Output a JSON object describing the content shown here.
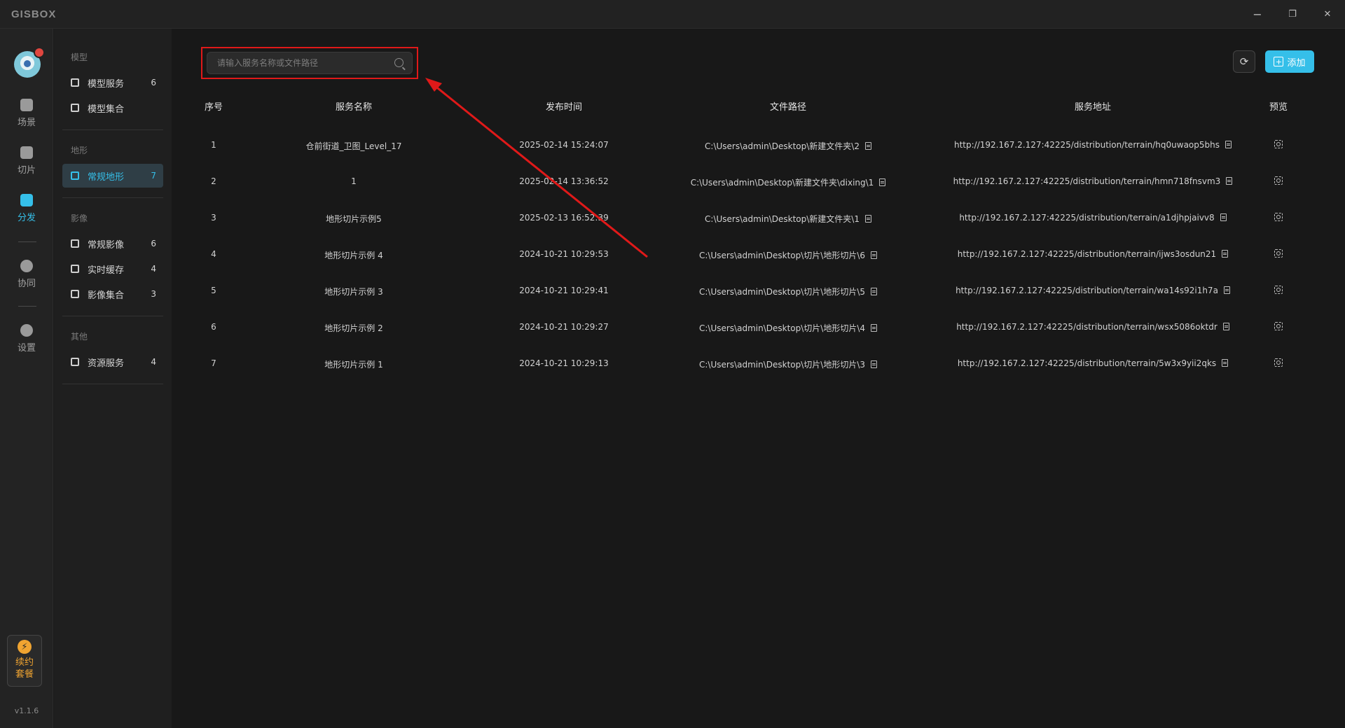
{
  "app": {
    "logo": "GISBOX"
  },
  "window": {
    "minimize": "−",
    "restore": "❐",
    "close": "✕"
  },
  "rail": {
    "items": [
      {
        "label": "场景"
      },
      {
        "label": "切片"
      },
      {
        "label": "分发"
      },
      {
        "label": "协同"
      },
      {
        "label": "设置"
      }
    ],
    "active": "分发",
    "renew": {
      "line1": "续约",
      "line2": "套餐",
      "icon": "⚡"
    },
    "version": "v1.1.6"
  },
  "sidebar": {
    "groups": [
      {
        "title": "模型",
        "items": [
          {
            "label": "模型服务",
            "count": "6"
          },
          {
            "label": "模型集合",
            "count": ""
          }
        ]
      },
      {
        "title": "地形",
        "items": [
          {
            "label": "常规地形",
            "count": "7"
          }
        ]
      },
      {
        "title": "影像",
        "items": [
          {
            "label": "常规影像",
            "count": "6"
          },
          {
            "label": "实时缓存",
            "count": "4"
          },
          {
            "label": "影像集合",
            "count": "3"
          }
        ]
      },
      {
        "title": "其他",
        "items": [
          {
            "label": "资源服务",
            "count": "4"
          }
        ]
      }
    ],
    "active_item": "常规地形"
  },
  "toolbar": {
    "search_placeholder": "请输入服务名称或文件路径",
    "search_value": "",
    "refresh_icon": "⟳",
    "add_label": "添加"
  },
  "table": {
    "headers": [
      "序号",
      "服务名称",
      "发布时间",
      "文件路径",
      "服务地址",
      "预览"
    ],
    "rows": [
      {
        "index": "1",
        "name": "仓前街道_卫图_Level_17",
        "time": "2025-02-14 15:24:07",
        "path": "C:\\Users\\admin\\Desktop\\新建文件夹\\2",
        "url": "http://192.167.2.127:42225/distribution/terrain/hq0uwaop5bhs"
      },
      {
        "index": "2",
        "name": "1",
        "time": "2025-02-14 13:36:52",
        "path": "C:\\Users\\admin\\Desktop\\新建文件夹\\dixing\\1",
        "url": "http://192.167.2.127:42225/distribution/terrain/hmn718fnsvm3"
      },
      {
        "index": "3",
        "name": "地形切片示例5",
        "time": "2025-02-13 16:52:39",
        "path": "C:\\Users\\admin\\Desktop\\新建文件夹\\1",
        "url": "http://192.167.2.127:42225/distribution/terrain/a1djhpjaivv8"
      },
      {
        "index": "4",
        "name": "地形切片示例 4",
        "time": "2024-10-21 10:29:53",
        "path": "C:\\Users\\admin\\Desktop\\切片\\地形切片\\6",
        "url": "http://192.167.2.127:42225/distribution/terrain/ijws3osdun21"
      },
      {
        "index": "5",
        "name": "地形切片示例 3",
        "time": "2024-10-21 10:29:41",
        "path": "C:\\Users\\admin\\Desktop\\切片\\地形切片\\5",
        "url": "http://192.167.2.127:42225/distribution/terrain/wa14s92i1h7a"
      },
      {
        "index": "6",
        "name": "地形切片示例 2",
        "time": "2024-10-21 10:29:27",
        "path": "C:\\Users\\admin\\Desktop\\切片\\地形切片\\4",
        "url": "http://192.167.2.127:42225/distribution/terrain/wsx5086oktdr"
      },
      {
        "index": "7",
        "name": "地形切片示例 1",
        "time": "2024-10-21 10:29:13",
        "path": "C:\\Users\\admin\\Desktop\\切片\\地形切片\\3",
        "url": "http://192.167.2.127:42225/distribution/terrain/5w3x9yii2qks"
      }
    ]
  },
  "colors": {
    "accent": "#35bfe9",
    "highlight": "#e01919",
    "renew": "#f0a431",
    "background": "#181818"
  }
}
